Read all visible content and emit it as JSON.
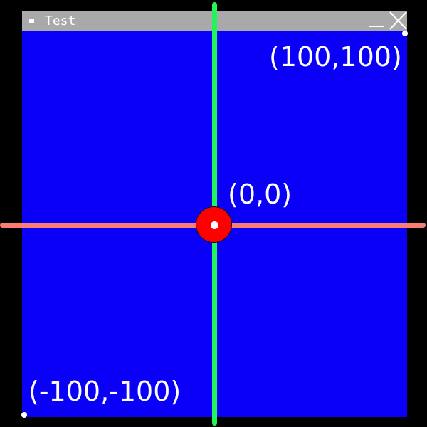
{
  "window": {
    "title": "Test",
    "background_color": "#0a00f7",
    "titlebar_color": "#a9a9a9",
    "controls": {
      "minimize_icon": "minimize-icon",
      "close_icon": "close-icon"
    }
  },
  "plot": {
    "axes": {
      "horizontal_color": "#fa7d73",
      "vertical_color": "#22f55a"
    },
    "origin_marker_color": "#ff0000",
    "labels": {
      "top_right": "(100,100)",
      "origin": "(0,0)",
      "bottom_left": "(-100,-100)"
    }
  }
}
